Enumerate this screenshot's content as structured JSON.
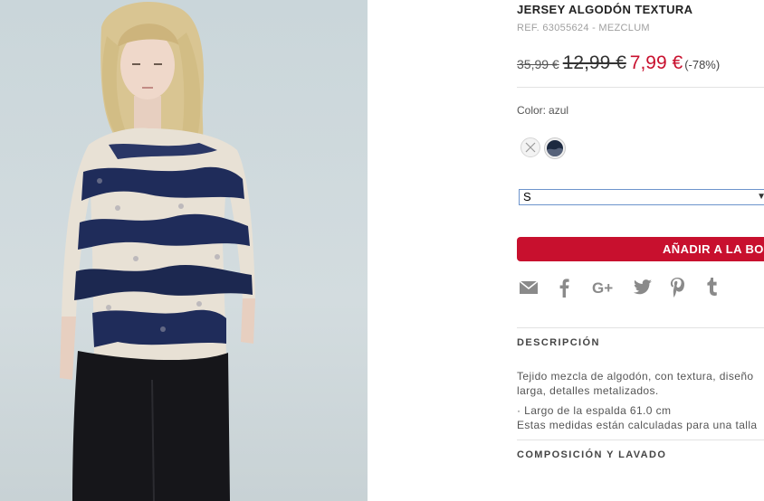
{
  "product": {
    "title": "JERSEY ALGODÓN TEXTURA",
    "reference": "REF. 63055624 - MEZCLUM"
  },
  "pricing": {
    "original": "35,99 €",
    "previous": "12,99 €",
    "sale": "7,99 €",
    "discount": "(-78%)"
  },
  "color": {
    "label": "Color:",
    "selected": "azul",
    "swatches": [
      {
        "name": "unavailable",
        "hex": "#f3f3f3"
      },
      {
        "name": "azul",
        "hex": "#1c2940"
      }
    ]
  },
  "size_select": {
    "value": "S"
  },
  "add_to_bag": {
    "label": "AÑADIR A LA BOLSA"
  },
  "share_icons": [
    "email-icon",
    "facebook-icon",
    "google-plus-icon",
    "twitter-icon",
    "pinterest-icon",
    "tumblr-icon"
  ],
  "description": {
    "heading": "DESCRIPCIÓN",
    "line1": "Tejido mezcla de algodón, con textura, diseño",
    "line2": "larga, detalles metalizados.",
    "line3": "· Largo de la espalda 61.0 cm",
    "line4": "Estas medidas están calculadas para una talla"
  },
  "composition": {
    "heading": "COMPOSICIÓN Y LAVADO"
  },
  "colors": {
    "accent": "#c8102e",
    "navy": "#1c2940",
    "select_border": "#6d94cc"
  }
}
